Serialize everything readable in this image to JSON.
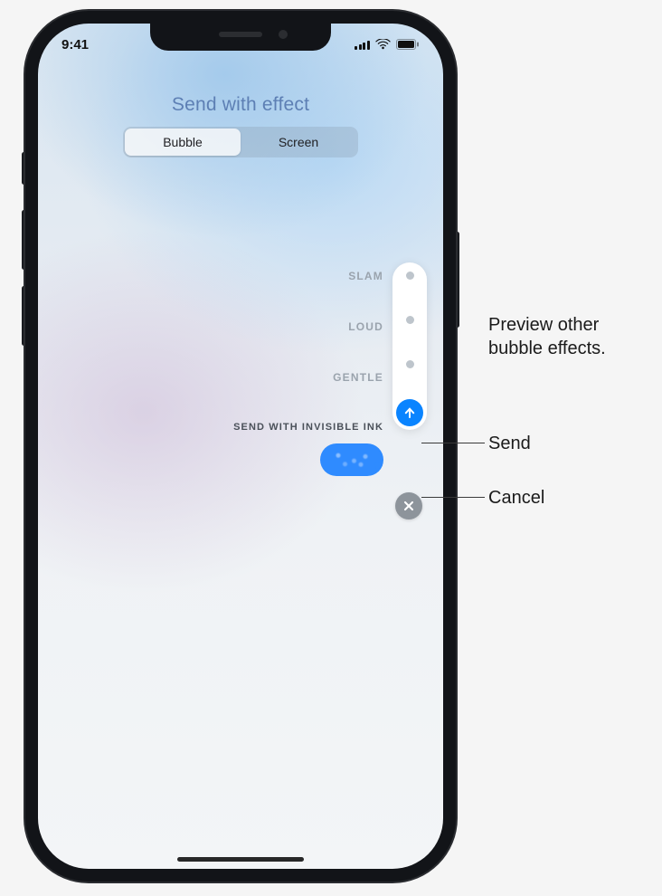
{
  "statusBar": {
    "time": "9:41"
  },
  "header": {
    "title": "Send with effect",
    "tabs": [
      {
        "label": "Bubble",
        "active": true
      },
      {
        "label": "Screen",
        "active": false
      }
    ]
  },
  "effects": {
    "options": [
      {
        "label": "SLAM"
      },
      {
        "label": "LOUD"
      },
      {
        "label": "GENTLE"
      }
    ],
    "selectedLabel": "SEND WITH INVISIBLE INK"
  },
  "actions": {
    "sendIcon": "arrow-up",
    "cancelIcon": "close"
  },
  "callouts": {
    "preview": "Preview other\nbubble effects.",
    "send": "Send",
    "cancel": "Cancel"
  }
}
